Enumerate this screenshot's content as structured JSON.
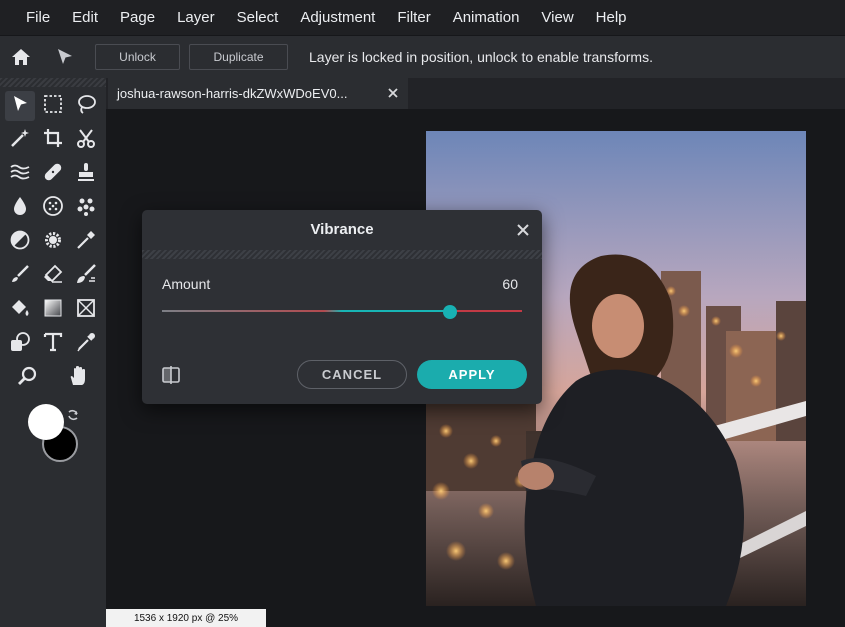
{
  "menubar": {
    "items": [
      "File",
      "Edit",
      "Page",
      "Layer",
      "Select",
      "Adjustment",
      "Filter",
      "Animation",
      "View",
      "Help"
    ]
  },
  "optionsbar": {
    "unlock_label": "Unlock",
    "duplicate_label": "Duplicate",
    "message": "Layer is locked in position, unlock to enable transforms."
  },
  "tab": {
    "title": "joshua-rawson-harris-dkZWxWDoEV0..."
  },
  "status": {
    "text": "1536 x 1920 px @ 25%"
  },
  "dialog": {
    "title": "Vibrance",
    "amount_label": "Amount",
    "amount_value": "60",
    "amount_fraction": 0.8,
    "cancel_label": "CANCEL",
    "apply_label": "APPLY"
  },
  "colors": {
    "accent": "#1bacad",
    "foreground": "#ffffff",
    "background": "#000000"
  },
  "tools": [
    "move-tool-icon",
    "marquee-tool-icon",
    "lasso-tool-icon",
    "magic-wand-icon",
    "crop-tool-icon",
    "cut-tool-icon",
    "liquify-icon",
    "healing-bandage-icon",
    "stamp-icon",
    "blur-drop-icon",
    "sponge-icon",
    "dots-pattern-icon",
    "dodge-burn-icon",
    "gear-icon",
    "color-picker-icon",
    "brush-icon",
    "eraser-icon",
    "smudge-brush-icon",
    "paint-bucket-icon",
    "gradient-icon",
    "shape-frame-icon",
    "drawing-tool-icon",
    "text-tool-icon",
    "eyedropper-icon",
    "zoom-icon",
    "hand-icon"
  ]
}
